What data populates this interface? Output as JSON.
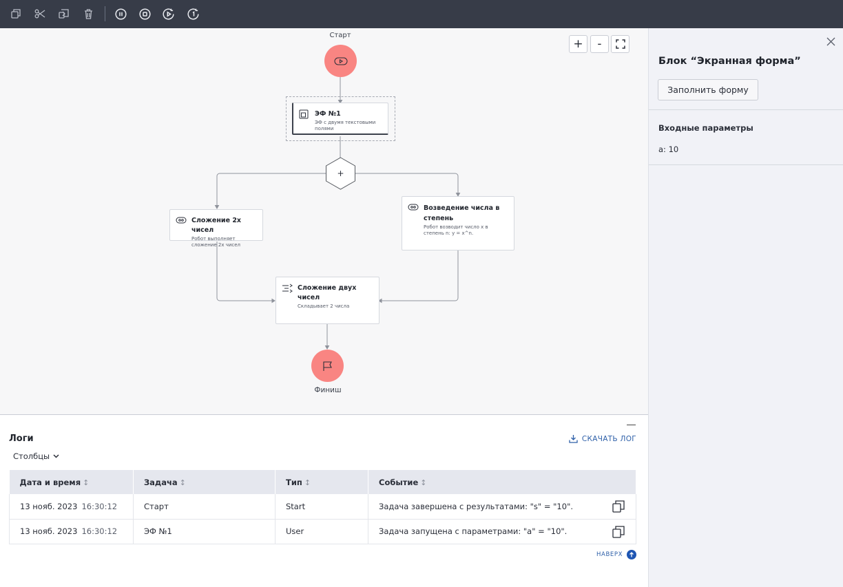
{
  "toolbar": {
    "buttons": [
      "copy-icon",
      "cut-icon",
      "paste-icon",
      "delete-icon",
      "pause-icon",
      "stop-icon",
      "play-icon",
      "rerun-icon"
    ]
  },
  "zoom": {
    "in": "+",
    "out": "-"
  },
  "flow": {
    "start_label": "Старт",
    "finish_label": "Финиш",
    "form_block": {
      "title": "ЭФ №1",
      "desc": "ЭФ с двумя текстовыми полями"
    },
    "add_block": {
      "title": "Сложение 2х чисел",
      "desc": "Робот выполняет сложение 2х чисел"
    },
    "power_block": {
      "title": "Возведение числа в степень",
      "desc": "Робот возводит число x в степень n: y = x^n."
    },
    "sum_block": {
      "title": "Сложение двух чисел",
      "desc": "Складывает 2 числа"
    },
    "gateway_label": "+"
  },
  "logs": {
    "title": "Логи",
    "columns_button": "Столбцы",
    "download_button": "СКАЧАТЬ ЛОГ",
    "headers": [
      "Дата и время",
      "Задача",
      "Тип",
      "Событие"
    ],
    "rows": [
      {
        "date": "13 нояб. 2023",
        "time": "16:30:12",
        "task": "Старт",
        "type": "Start",
        "event": "Задача завершена с результатами: \"s\" = \"10\"."
      },
      {
        "date": "13 нояб. 2023",
        "time": "16:30:12",
        "task": "ЭФ №1",
        "type": "User",
        "event": "Задача запущена с параметрами: \"a\" = \"10\"."
      }
    ],
    "top_link": "НАВЕРХ"
  },
  "panel": {
    "title": "Блок “Экранная форма”",
    "fill_button": "Заполнить форму",
    "inputs_title": "Входные параметры",
    "inputs_value": "a: 10"
  },
  "colors": {
    "toolbar_bg": "#373c48",
    "node_accent": "#f98582",
    "link_blue": "#2d5fa8",
    "panel_bg": "#f1f2f7"
  }
}
